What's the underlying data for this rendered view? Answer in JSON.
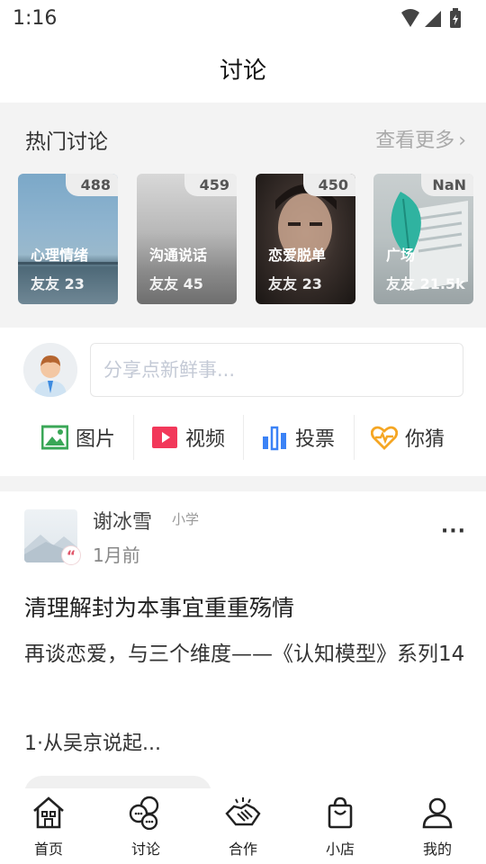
{
  "status": {
    "time": "1:16"
  },
  "header": {
    "title": "讨论"
  },
  "hot": {
    "title": "热门讨论",
    "more": "查看更多",
    "cards": [
      {
        "count": "488",
        "name": "心理情绪",
        "members": "友友 23"
      },
      {
        "count": "459",
        "name": "沟通说话",
        "members": "友友 45"
      },
      {
        "count": "450",
        "name": "恋爱脱单",
        "members": "友友 23"
      },
      {
        "count": "NaN",
        "name": "广场",
        "members": "友友 21.5k"
      }
    ]
  },
  "composer": {
    "placeholder": "分享点新鲜事...",
    "actions": [
      {
        "label": "图片",
        "icon": "image-icon",
        "color": "#3aa757"
      },
      {
        "label": "视频",
        "icon": "video-icon",
        "color": "#f2385a"
      },
      {
        "label": "投票",
        "icon": "vote-chart-icon",
        "color": "#3b82f6"
      },
      {
        "label": "你猜",
        "icon": "heartbeat-icon",
        "color": "#f5a623"
      }
    ]
  },
  "post": {
    "author": "谢冰雪",
    "author_tag": "小学",
    "time": "1月前",
    "title": "清理解封为本事宜重重殇情",
    "body": "再谈恋爱，与三个维度——《认知模型》系列14",
    "excerpt": "1·从吴京说起...",
    "more": "···"
  },
  "tabbar": {
    "items": [
      {
        "label": "首页",
        "icon": "home-icon"
      },
      {
        "label": "讨论",
        "icon": "discussion-icon"
      },
      {
        "label": "合作",
        "icon": "handshake-icon"
      },
      {
        "label": "小店",
        "icon": "shopping-bag-icon"
      },
      {
        "label": "我的",
        "icon": "profile-icon"
      }
    ]
  }
}
